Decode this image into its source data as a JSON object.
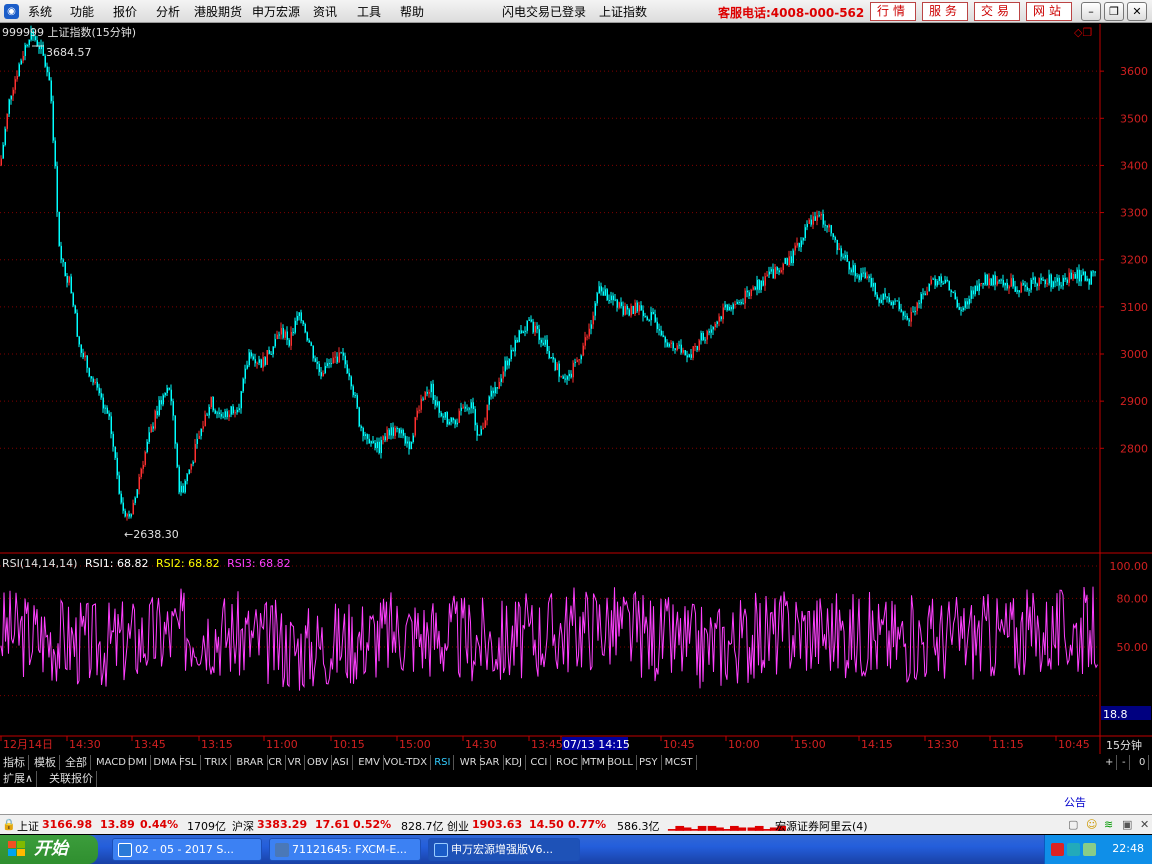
{
  "menubar": {
    "items": [
      "系统",
      "功能",
      "报价",
      "分析",
      "港股期货",
      "申万宏源",
      "资讯",
      "工具",
      "帮助"
    ],
    "status": "闪电交易已登录",
    "current_index_name": "上证指数",
    "hotline": "客服电话:4008-000-562",
    "buttons": [
      "行情",
      "服务",
      "交易",
      "网站"
    ]
  },
  "chart": {
    "title": "999999 上证指数(15分钟)",
    "high_label": "3684.57",
    "low_label": "2638.30",
    "price_axis": [
      "3600",
      "3500",
      "3400",
      "3300",
      "3200",
      "3100",
      "3000",
      "2900",
      "2800"
    ],
    "rsi_header_name": "RSI(14,14,14)",
    "rsi1_label": "RSI1: 68.82",
    "rsi2_label": "RSI2: 68.82",
    "rsi3_label": "RSI3: 68.82",
    "rsi_axis": [
      "100.00",
      "80.00",
      "50.00"
    ],
    "rsi_current_badge": "18.8",
    "time_axis": [
      "12月14日",
      "14:30",
      "13:45",
      "13:15",
      "11:00",
      "10:15",
      "15:00",
      "14:30",
      "13:45",
      "07/13 14:15",
      "10:45",
      "10:00",
      "15:00",
      "14:15",
      "13:30",
      "11:15",
      "10:45"
    ],
    "period_label": "15分钟",
    "colors": {
      "candle": "#00ffff",
      "candle_up": "#ff3030",
      "rsi": "#ff40ff",
      "axis": "#c00000",
      "grid": "#800000"
    }
  },
  "chart_data": {
    "type": "line",
    "title": "999999 上证指数(15分钟)",
    "series": [
      {
        "name": "上证指数",
        "x": [
          0,
          10,
          20,
          30,
          40,
          50,
          60,
          70,
          80,
          90,
          100,
          110,
          120,
          130,
          140,
          150,
          160,
          170,
          180,
          190,
          200,
          210,
          220,
          230,
          240,
          250,
          260,
          270,
          280,
          290,
          300,
          310,
          320,
          330,
          340,
          350,
          360,
          370,
          380,
          390,
          400,
          410,
          420,
          430,
          440,
          450,
          460,
          470,
          480,
          490,
          500,
          510,
          520,
          530,
          540,
          550,
          560,
          570,
          580,
          590,
          600,
          610,
          620,
          630,
          640,
          650,
          660,
          670,
          680,
          690,
          700,
          710,
          720,
          730,
          740,
          750,
          760,
          770,
          780,
          790,
          800,
          810,
          820,
          830,
          840,
          850,
          860,
          870,
          880,
          890,
          900,
          910,
          920,
          930,
          940,
          950,
          960,
          970,
          980,
          990,
          1000,
          1010,
          1020,
          1030,
          1040,
          1050,
          1060,
          1070,
          1080,
          1090,
          1100
        ],
        "values": [
          3400,
          3550,
          3620,
          3684.57,
          3650,
          3580,
          3200,
          3150,
          3010,
          2960,
          2900,
          2850,
          2700,
          2638.3,
          2750,
          2830,
          2900,
          2930,
          2700,
          2760,
          2830,
          2900,
          2870,
          2880,
          2900,
          3010,
          2980,
          3000,
          3050,
          3030,
          3090,
          3020,
          2960,
          2980,
          3000,
          2960,
          2850,
          2820,
          2800,
          2840,
          2830,
          2810,
          2900,
          2930,
          2880,
          2850,
          2870,
          2900,
          2820,
          2910,
          2950,
          3000,
          3050,
          3060,
          3040,
          3000,
          2960,
          2950,
          3000,
          3050,
          3140,
          3120,
          3100,
          3090,
          3100,
          3080,
          3060,
          3020,
          3010,
          2990,
          3030,
          3050,
          3080,
          3100,
          3110,
          3130,
          3150,
          3170,
          3180,
          3200,
          3230,
          3280,
          3300,
          3260,
          3220,
          3190,
          3170,
          3150,
          3120,
          3110,
          3100,
          3080,
          3110,
          3150,
          3160,
          3140,
          3100,
          3120,
          3150,
          3160,
          3160,
          3150,
          3140,
          3150,
          3160,
          3155,
          3150,
          3160,
          3166.98,
          3160,
          3166.98
        ]
      },
      {
        "name": "RSI1",
        "x": [
          0,
          100,
          200,
          300,
          400,
          500,
          600,
          700,
          800,
          900,
          1000,
          1100
        ],
        "values": [
          68,
          45,
          72,
          40,
          66,
          50,
          78,
          42,
          70,
          55,
          60,
          68.82
        ]
      }
    ],
    "xlabel": "",
    "ylabel": "",
    "ylim": [
      2580,
      3700
    ]
  },
  "indicator_tabs": [
    "指标",
    "模板",
    "全部",
    "MACD",
    "DMI",
    "DMA",
    "FSL",
    "TRIX",
    "BRAR",
    "CR",
    "VR",
    "OBV",
    "ASI",
    "EMV",
    "VOL-TDX",
    "RSI",
    "WR",
    "SAR",
    "KDJ",
    "CCI",
    "ROC",
    "MTM",
    "BOLL",
    "PSY",
    "MCST"
  ],
  "active_indicator": "RSI",
  "zoom_buttons": [
    "+",
    "-",
    "0"
  ],
  "ext_tabs": [
    "扩展∧",
    "关联报价"
  ],
  "notice_link": "公告",
  "ticker": {
    "sh_name": "上证",
    "sh_value": "3166.98",
    "sh_change": "13.89",
    "sh_pct": "0.44%",
    "sh_amount": "1709亿",
    "hs_name": "沪深",
    "hs_value": "3383.29",
    "hs_change": "17.61",
    "hs_pct": "0.52%",
    "hs_amount": "828.7亿",
    "cy_name": "创业",
    "cy_value": "1903.63",
    "cy_change": "14.50",
    "cy_pct": "0.77%",
    "cy_amount": "586.3亿",
    "broker": "宏源证券阿里云(4)"
  },
  "taskbar": {
    "start": "开始",
    "tasks": [
      "02 - 05 - 2017 S...",
      "71121645: FXCM-E...",
      "申万宏源增强版V6..."
    ],
    "clock": "22:48"
  }
}
